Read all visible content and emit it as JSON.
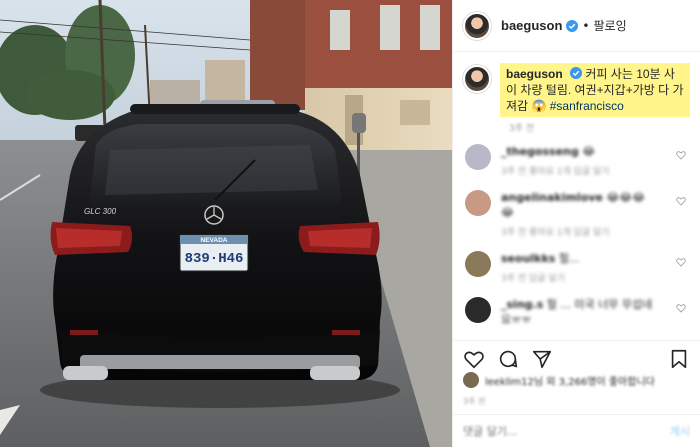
{
  "post": {
    "username": "baeguson",
    "follow_label": "팔로잉",
    "separator": "•",
    "caption": {
      "username": "baeguson",
      "text": "커피 사는 10분 사이 차량 털림. 여권+지갑+가방 다 가져감",
      "emoji": "😱",
      "hashtag": "#sanfrancisco",
      "time": "3주 전"
    }
  },
  "photo": {
    "license_plate": {
      "state": "NEVADA",
      "number": "839·H46"
    },
    "badge": "GLC 300"
  },
  "comments": [
    {
      "user": "_thegosseng",
      "text": "😂 ",
      "meta": "3주 전  좋아요 1개  답글 달기",
      "avatar_color": "#b8b8c8"
    },
    {
      "user": "angelinakimlove",
      "text": "😂😂😂 😂",
      "meta": "3주 전  좋아요 1개  답글 달기",
      "avatar_color": "#c89a84"
    },
    {
      "user": "seoulkks",
      "text": "헐...",
      "meta": "3주 전  답글 달기",
      "avatar_color": "#8a7a5a"
    },
    {
      "user": "_sing.s",
      "text": "헐 ... 미국 너무 무섭네요ㅠㅠ",
      "meta": "3주 전  답글 달기",
      "avatar_color": "#2a2a2a"
    }
  ],
  "likes": {
    "text": "leeklim12님 외 3,266명이 좋아합니다"
  },
  "post_time": "3주 전",
  "add_comment": {
    "placeholder": "댓글 달기...",
    "post_label": "게시"
  },
  "colors": {
    "highlight": "#fff58a",
    "verified": "#3897f0",
    "hashtag": "#003569"
  }
}
